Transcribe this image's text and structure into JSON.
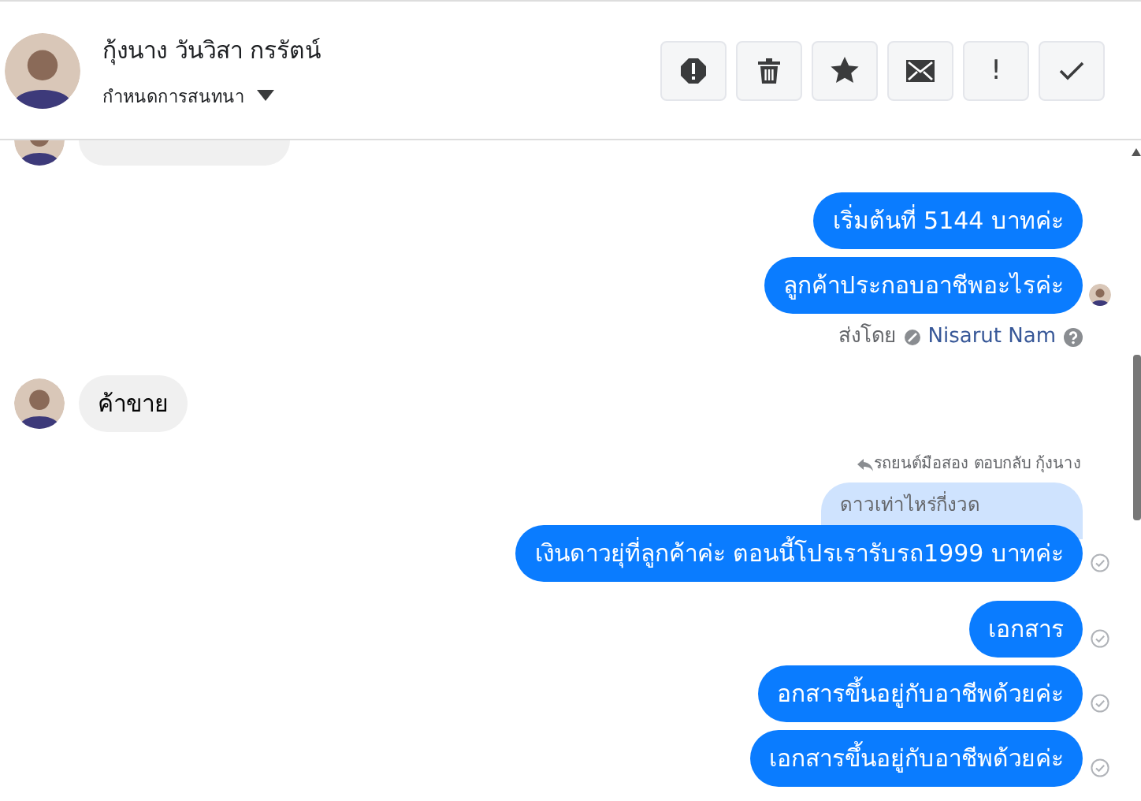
{
  "header": {
    "name": "กุ้งนาง วันวิสา กรรัตน์",
    "subtitle": "กำหนดการสนทนา",
    "buttons": [
      {
        "kind": "report"
      },
      {
        "kind": "delete"
      },
      {
        "kind": "star"
      },
      {
        "kind": "unread"
      },
      {
        "kind": "important",
        "text": "!"
      },
      {
        "kind": "done"
      }
    ]
  },
  "messages": [
    {
      "kind": "incoming_hidden"
    },
    {
      "kind": "outgoing",
      "text": "เริ่มต้นที่ 5144 บาทค่ะ",
      "seen": false,
      "delivered": false
    },
    {
      "kind": "outgoing",
      "text": "ลูกค้าประกอบอาชีพอะไรค่ะ",
      "seen": true,
      "delivered": false
    },
    {
      "kind": "sent_by",
      "label": "ส่งโดย",
      "name": "Nisarut Nam"
    },
    {
      "kind": "incoming",
      "text": "ค้าขาย"
    },
    {
      "kind": "reply",
      "label": "รถยนต์มือสอง ตอบกลับ กุ้งนาง",
      "quote": "ดาวเท่าไหร่กี่งวด"
    },
    {
      "kind": "outgoing",
      "text": "เงินดาวยุ่ที่ลูกค้าค่ะ  ตอนนี้โปรเรารับรถ1999 บาทค่ะ",
      "seen": false,
      "delivered": true
    },
    {
      "kind": "outgoing",
      "text": "เอกสาร",
      "seen": false,
      "delivered": true
    },
    {
      "kind": "outgoing",
      "text": "อกสารขึ้นอยู่กับอาชีพด้วยค่ะ",
      "seen": false,
      "delivered": true
    },
    {
      "kind": "outgoing",
      "text": "เอกสารขึ้นอยู่กับอาชีพด้วยค่ะ",
      "seen": false,
      "delivered": true
    }
  ]
}
